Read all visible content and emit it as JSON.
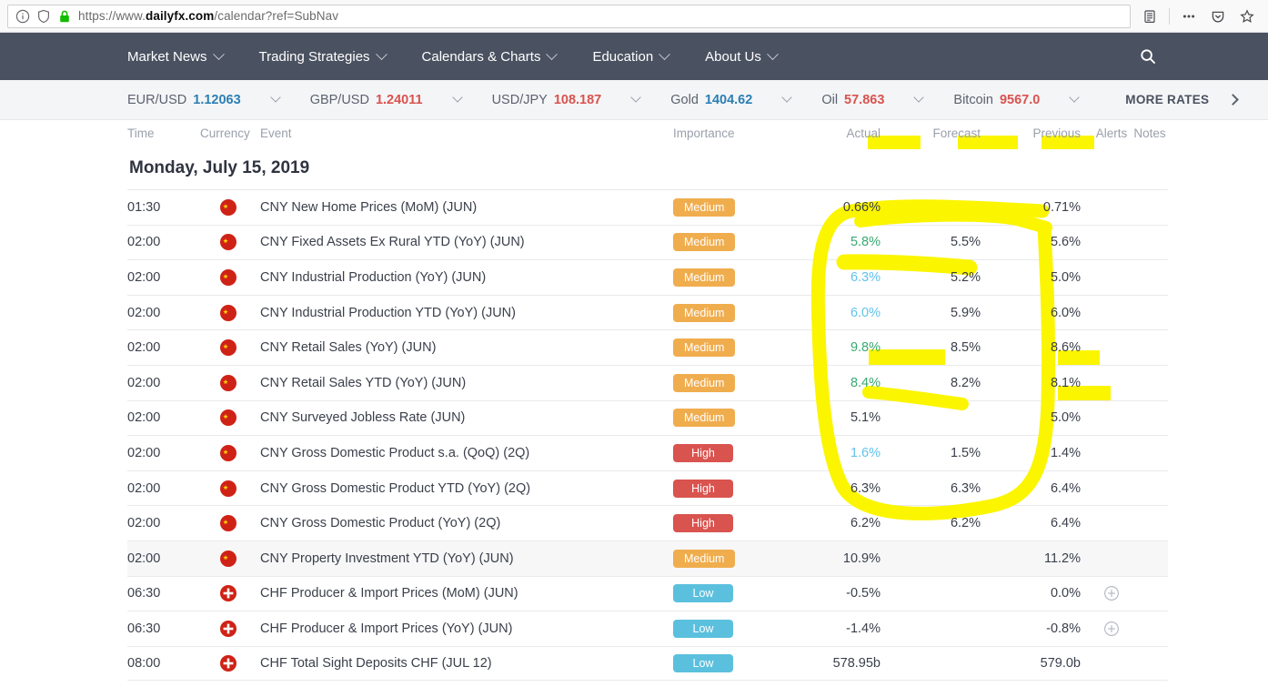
{
  "browser": {
    "url_prefix": "https://www.",
    "url_domain": "dailyfx.com",
    "url_suffix": "/calendar?ref=SubNav",
    "icons": {
      "info": "info-icon",
      "shield": "shield-icon",
      "lock": "lock-icon",
      "reader": "reader-view-icon",
      "menu": "ellipsis-menu-icon",
      "pocket": "pocket-save-icon",
      "bookmark": "star-bookmark-icon"
    }
  },
  "nav": {
    "items": [
      {
        "label": "Market News",
        "caret": true
      },
      {
        "label": "Trading Strategies",
        "caret": true
      },
      {
        "label": "Calendars & Charts",
        "caret": true
      },
      {
        "label": "Education",
        "caret": true
      },
      {
        "label": "About Us",
        "caret": true
      }
    ],
    "search_icon": "search-icon",
    "bg_color": "#4a5160"
  },
  "rates": {
    "items": [
      {
        "name": "EUR/USD",
        "value": "1.12063",
        "dir": "up"
      },
      {
        "name": "GBP/USD",
        "value": "1.24011",
        "dir": "down"
      },
      {
        "name": "USD/JPY",
        "value": "108.187",
        "dir": "down"
      },
      {
        "name": "Gold",
        "value": "1404.62",
        "dir": "up"
      },
      {
        "name": "Oil",
        "value": "57.863",
        "dir": "down"
      },
      {
        "name": "Bitcoin",
        "value": "9567.0",
        "dir": "down"
      }
    ],
    "more_label": "MORE RATES",
    "colors": {
      "up": "#2b7fb3",
      "down": "#d9534f"
    }
  },
  "calendar": {
    "columns": {
      "time": "Time",
      "currency": "Currency",
      "event": "Event",
      "importance": "Importance",
      "actual": "Actual",
      "forecast": "Forecast",
      "previous": "Previous",
      "alerts": "Alerts",
      "notes": "Notes"
    },
    "date_title": "Monday, July 15, 2019",
    "rows": [
      {
        "time": "01:30",
        "flag": "cn-flag-icon",
        "event": "CNY New Home Prices (MoM) (JUN)",
        "importance": "Medium",
        "actual": "0.66%",
        "actual_color": "dark",
        "forecast": "",
        "previous": "0.71%",
        "alert": false,
        "alt": false
      },
      {
        "time": "02:00",
        "flag": "cn-flag-icon",
        "event": "CNY Fixed Assets Ex Rural YTD (YoY) (JUN)",
        "importance": "Medium",
        "actual": "5.8%",
        "actual_color": "green",
        "forecast": "5.5%",
        "previous": "5.6%",
        "alert": false,
        "alt": false
      },
      {
        "time": "02:00",
        "flag": "cn-flag-icon",
        "event": "CNY Industrial Production (YoY) (JUN)",
        "importance": "Medium",
        "actual": "6.3%",
        "actual_color": "blue",
        "forecast": "5.2%",
        "previous": "5.0%",
        "alert": false,
        "alt": false
      },
      {
        "time": "02:00",
        "flag": "cn-flag-icon",
        "event": "CNY Industrial Production YTD (YoY) (JUN)",
        "importance": "Medium",
        "actual": "6.0%",
        "actual_color": "blue",
        "forecast": "5.9%",
        "previous": "6.0%",
        "alert": false,
        "alt": false
      },
      {
        "time": "02:00",
        "flag": "cn-flag-icon",
        "event": "CNY Retail Sales (YoY) (JUN)",
        "importance": "Medium",
        "actual": "9.8%",
        "actual_color": "green",
        "forecast": "8.5%",
        "previous": "8.6%",
        "alert": false,
        "alt": false
      },
      {
        "time": "02:00",
        "flag": "cn-flag-icon",
        "event": "CNY Retail Sales YTD (YoY) (JUN)",
        "importance": "Medium",
        "actual": "8.4%",
        "actual_color": "green",
        "forecast": "8.2%",
        "previous": "8.1%",
        "alert": false,
        "alt": false
      },
      {
        "time": "02:00",
        "flag": "cn-flag-icon",
        "event": "CNY Surveyed Jobless Rate (JUN)",
        "importance": "Medium",
        "actual": "5.1%",
        "actual_color": "dark",
        "forecast": "",
        "previous": "5.0%",
        "alert": false,
        "alt": false
      },
      {
        "time": "02:00",
        "flag": "cn-flag-icon",
        "event": "CNY Gross Domestic Product s.a. (QoQ) (2Q)",
        "importance": "High",
        "actual": "1.6%",
        "actual_color": "blue",
        "forecast": "1.5%",
        "previous": "1.4%",
        "alert": false,
        "alt": false
      },
      {
        "time": "02:00",
        "flag": "cn-flag-icon",
        "event": "CNY Gross Domestic Product YTD (YoY) (2Q)",
        "importance": "High",
        "actual": "6.3%",
        "actual_color": "dark",
        "forecast": "6.3%",
        "previous": "6.4%",
        "alert": false,
        "alt": false
      },
      {
        "time": "02:00",
        "flag": "cn-flag-icon",
        "event": "CNY Gross Domestic Product (YoY) (2Q)",
        "importance": "High",
        "actual": "6.2%",
        "actual_color": "dark",
        "forecast": "6.2%",
        "previous": "6.4%",
        "alert": false,
        "alt": false
      },
      {
        "time": "02:00",
        "flag": "cn-flag-icon",
        "event": "CNY Property Investment YTD (YoY) (JUN)",
        "importance": "Medium",
        "actual": "10.9%",
        "actual_color": "dark",
        "forecast": "",
        "previous": "11.2%",
        "alert": false,
        "alt": true
      },
      {
        "time": "06:30",
        "flag": "ch-flag-icon",
        "event": "CHF Producer & Import Prices (MoM) (JUN)",
        "importance": "Low",
        "actual": "-0.5%",
        "actual_color": "dark",
        "forecast": "",
        "previous": "0.0%",
        "alert": true,
        "alt": false
      },
      {
        "time": "06:30",
        "flag": "ch-flag-icon",
        "event": "CHF Producer & Import Prices (YoY) (JUN)",
        "importance": "Low",
        "actual": "-1.4%",
        "actual_color": "dark",
        "forecast": "",
        "previous": "-0.8%",
        "alert": true,
        "alt": false
      },
      {
        "time": "08:00",
        "flag": "ch-flag-icon",
        "event": "CHF Total Sight Deposits CHF (JUL 12)",
        "importance": "Low",
        "actual": "578.95b",
        "actual_color": "dark",
        "forecast": "",
        "previous": "579.0b",
        "alert": false,
        "alt": false
      }
    ]
  },
  "annotations": {
    "color": "#fbf500",
    "marks": [
      "highlight-header-actual",
      "highlight-header-forecast",
      "highlight-header-previous",
      "oval-around-actual-column",
      "underline-5.8",
      "highlight-9.8",
      "underline-8.4",
      "highlight-8.6",
      "highlight-8.1"
    ]
  }
}
